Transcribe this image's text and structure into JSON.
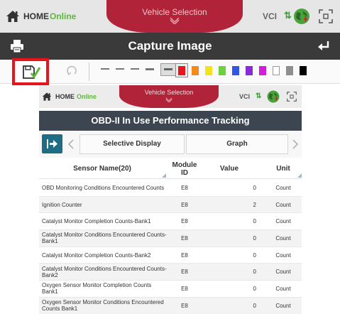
{
  "topbar": {
    "home_label": "HOME",
    "status": "Online",
    "vehicle_selection": "Vehicle Selection",
    "vci_label": "VCI",
    "vci_arrows": "⇅"
  },
  "capture": {
    "title": "Capture Image"
  },
  "toolbar": {
    "icons": [
      "save-icon",
      "undo-icon"
    ],
    "colors": [
      "#e8151c",
      "#f28a1c",
      "#f4e21c",
      "#6bd23c",
      "#2f56e8",
      "#8a2ad6",
      "#d21ed8",
      "#ffffff",
      "#8e8e8e",
      "#000000"
    ],
    "selected_color": "#e8151c"
  },
  "inner": {
    "topbar": {
      "home_label": "HOME",
      "status": "Online",
      "vehicle_selection": "Vehicle Selection",
      "vci_label": "VCI",
      "vci_arrows": "⇅"
    },
    "title": "OBD-II In Use Performance Tracking",
    "controls": {
      "selective_display": "Selective Display",
      "graph": "Graph"
    },
    "table": {
      "headers": {
        "sensor": "Sensor Name(20)",
        "module": "Module ID",
        "value": "Value",
        "unit": "Unit"
      },
      "rows": [
        {
          "sensor": "OBD Monitoring Conditions Encountered Counts",
          "module": "E8",
          "value": "0",
          "unit": "Count"
        },
        {
          "sensor": "Ignition Counter",
          "module": "E8",
          "value": "2",
          "unit": "Count"
        },
        {
          "sensor": "Catalyst Monitor Completion Counts-Bank1",
          "module": "E8",
          "value": "0",
          "unit": "Count"
        },
        {
          "sensor": "Catalyst Monitor Conditions Encountered Counts-Bank1",
          "module": "E8",
          "value": "0",
          "unit": "Count"
        },
        {
          "sensor": "Catalyst Monitor Completion Counts-Bank2",
          "module": "E8",
          "value": "0",
          "unit": "Count"
        },
        {
          "sensor": "Catalyst Monitor Conditions Encountered Counts-Bank2",
          "module": "E8",
          "value": "0",
          "unit": "Count"
        },
        {
          "sensor": "Oxygen Sensor Monitor Completion Counts Bank1",
          "module": "E8",
          "value": "0",
          "unit": "Count"
        },
        {
          "sensor": "Oxygen Sensor Monitor Conditions Encountered Counts Bank1",
          "module": "E8",
          "value": "0",
          "unit": "Count"
        }
      ]
    }
  }
}
